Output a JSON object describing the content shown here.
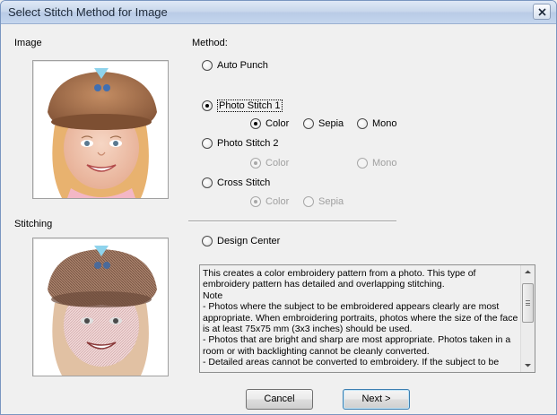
{
  "window": {
    "title": "Select Stitch Method for Image"
  },
  "left": {
    "image_label": "Image",
    "stitching_label": "Stitching"
  },
  "method": {
    "label": "Method:",
    "options": {
      "auto_punch": "Auto Punch",
      "photo_stitch_1": "Photo Stitch 1",
      "photo_stitch_2": "Photo Stitch 2",
      "cross_stitch": "Cross Stitch",
      "design_center": "Design Center"
    },
    "selected": "Photo Stitch 1",
    "photo_stitch_1_colors": [
      "Color",
      "Sepia",
      "Mono"
    ],
    "photo_stitch_2_colors": [
      "Color",
      "Mono"
    ],
    "cross_stitch_colors": [
      "Color",
      "Sepia"
    ]
  },
  "description": "This creates a color embroidery pattern from a photo. This type of embroidery pattern has detailed and overlapping stitching.\nNote\n- Photos where the subject to be embroidered appears clearly are most appropriate. When embroidering portraits, photos where the size of the face is at least 75x75 mm (3x3 inches) should be used.\n- Photos that are bright and sharp are most appropriate. Photos taken in a room or with backlighting cannot be cleanly converted.\n- Detailed areas cannot be converted to embroidery. If the subject to be",
  "buttons": {
    "cancel": "Cancel",
    "next": "Next >"
  },
  "icons": {
    "close": "close-icon",
    "scroll_up": "scroll-up-arrow-icon",
    "scroll_down": "scroll-down-arrow-icon"
  }
}
